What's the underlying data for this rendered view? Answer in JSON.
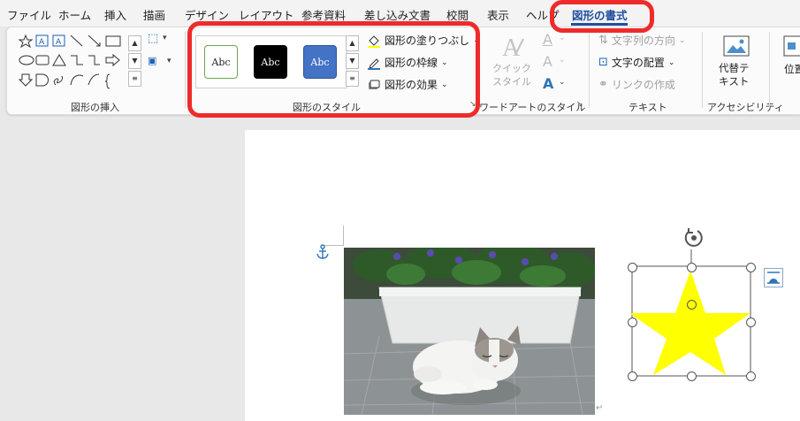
{
  "menu": {
    "tabs": [
      "ファイル",
      "ホーム",
      "挿入",
      "描画",
      "デザイン",
      "レイアウト",
      "参考資料",
      "差し込み文書",
      "校閲",
      "表示",
      "ヘルプ"
    ],
    "active_tab": "図形の書式"
  },
  "ribbon": {
    "insert_shapes": {
      "label": "図形の挿入"
    },
    "shape_styles": {
      "label": "図形のスタイル",
      "presets": [
        "Abc",
        "Abc",
        "Abc"
      ],
      "fill": "図形の塗りつぶし",
      "outline": "図形の枠線",
      "effects": "図形の効果"
    },
    "wordart": {
      "label": "ワードアートのスタイル",
      "quick_style": "クイック\nスタイル"
    },
    "text": {
      "label": "テキスト",
      "direction": "文字列の方向",
      "align": "文字の配置",
      "link": "リンクの作成"
    },
    "accessibility": {
      "label": "アクセシビリティ",
      "alt_text": "代替テ\nキスト"
    },
    "arrange": {
      "position": "位置"
    }
  },
  "colors": {
    "highlight": "#ee2b2b",
    "active_tab": "#1f4e9e",
    "star_fill": "#ffff00",
    "fill_underline": "#ffff00",
    "outline_underline": "#2e75b6"
  },
  "icons": [
    "anchor-icon",
    "rotate-handle-icon",
    "layout-options-icon",
    "paint-bucket-icon",
    "pen-outline-icon",
    "effects-icon",
    "wordart-a-icon",
    "alt-text-icon"
  ]
}
